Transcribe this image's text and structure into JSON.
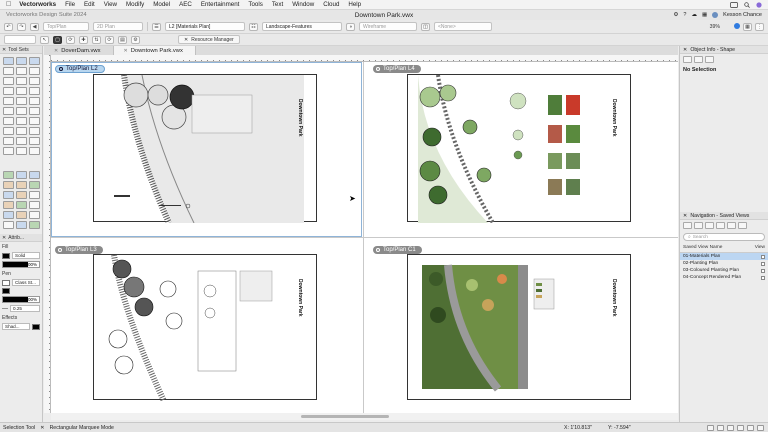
{
  "menubar": {
    "app": "Vectorworks",
    "items": [
      "File",
      "Edit",
      "View",
      "Modify",
      "Model",
      "AEC",
      "Entertainment",
      "Tools",
      "Text",
      "Window",
      "Cloud",
      "Help"
    ]
  },
  "titlebar": {
    "app_name": "Vectorworks Design Suite 2024",
    "doc_title": "Downtown Park.vwx",
    "user": "Kesson Chance"
  },
  "toolbar": {
    "view_combo": "Top/Plan",
    "plane_combo": "2D Plan",
    "layer_combo": "L2 [Materials Plan]",
    "class_combo": "Landscape-Features",
    "render_combo": "Wireframe",
    "proj_combo": "<None>",
    "zoom": "39%",
    "resource_manager": "Resource Manager"
  },
  "tabs": {
    "tab1": "DoverDam.vwx",
    "tab2": "Downtown Park.vwx"
  },
  "left": {
    "tool_sets": "Tool Sets",
    "attributes": "Attrib...",
    "fill_label": "Fill",
    "fill_value": "Solid",
    "opacity1": "100%",
    "pen_label": "Pen",
    "pen_value": "Class St...",
    "opacity2": "100%",
    "lineweight": "0.25",
    "effects": "Effects",
    "shadow": "Shad..."
  },
  "viewports": {
    "v1": "Top/Plan  L2",
    "v2": "Top/Plan  L4",
    "v3": "Top/Plan  L3",
    "v4": "Top/Plan  C1",
    "sheet_title": "Downtown Park"
  },
  "right": {
    "obj_info": "Object Info - Shape",
    "no_selection": "No Selection",
    "nav": "Navigation - Saved Views",
    "search": "Search",
    "col_name": "Saved View Name",
    "col_view": "View",
    "views": [
      "01-Materials Plan",
      "02-Planting Plan",
      "03-Coloured Planting Plan",
      "04-Concept Rendered Plan"
    ]
  },
  "status": {
    "tool": "Selection Tool",
    "mode": "Rectangular Marquee Mode",
    "x": "X: 1'10.813\"",
    "y": "Y: -7.594\""
  }
}
